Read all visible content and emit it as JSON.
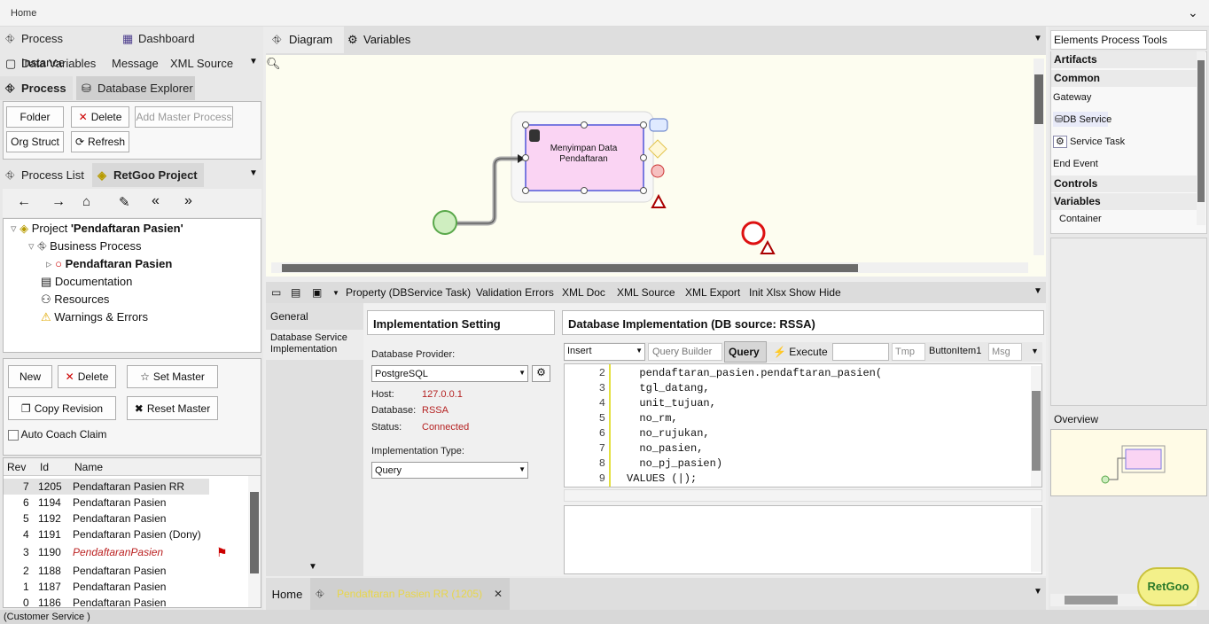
{
  "topbar": {
    "home": "Home"
  },
  "left": {
    "row1": {
      "process_instance": "Process Instance",
      "dashboard": "Dashboard"
    },
    "row2": {
      "data_variables": "Data Variables",
      "message": "Message",
      "xml_source": "XML Source"
    },
    "row3": {
      "process": "Process",
      "database_explorer": "Database Explorer"
    },
    "buttons": {
      "folder": "Folder",
      "delete": "Delete",
      "add_master": "Add Master Process",
      "org_struct": "Org Struct",
      "refresh": "Refresh"
    },
    "row4": {
      "process_list": "Process List",
      "retgoo_project": "RetGoo Project"
    },
    "tree": {
      "project_prefix": "Project ",
      "project_name": "'Pendaftaran Pasien'",
      "business_process": "Business Process",
      "pendaftaran": "Pendaftaran Pasien",
      "documentation": "Documentation",
      "resources": "Resources",
      "warnings": "Warnings & Errors"
    },
    "rev_buttons": {
      "new": "New",
      "delete": "Delete",
      "set_master": "Set Master",
      "copy_revision": "Copy Revision",
      "reset_master": "Reset Master",
      "auto_coach": "Auto Coach Claim"
    },
    "table": {
      "headers": [
        "Rev",
        "Id",
        "Name"
      ],
      "rows": [
        {
          "rev": "7",
          "id": "1205",
          "name": "Pendaftaran Pasien RR"
        },
        {
          "rev": "6",
          "id": "1194",
          "name": "Pendaftaran Pasien"
        },
        {
          "rev": "5",
          "id": "1192",
          "name": "Pendaftaran Pasien"
        },
        {
          "rev": "4",
          "id": "1191",
          "name": "Pendaftaran Pasien (Dony)"
        },
        {
          "rev": "3",
          "id": "1190",
          "name": "PendaftaranPasien"
        },
        {
          "rev": "2",
          "id": "1188",
          "name": "Pendaftaran Pasien"
        },
        {
          "rev": "1",
          "id": "1187",
          "name": "Pendaftaran Pasien"
        },
        {
          "rev": "0",
          "id": "1186",
          "name": "Pendaftaran Pasien"
        }
      ]
    }
  },
  "center": {
    "tabs": {
      "diagram": "Diagram",
      "variables": "Variables"
    },
    "task_label": "Menyimpan Data Pendaftaran",
    "prop_tabs": [
      "Property (DBService Task)",
      "Validation Errors",
      "XML Doc",
      "XML Source",
      "XML Export",
      "Init Xlsx",
      "Show",
      "Hide"
    ],
    "side": {
      "general": "General",
      "db_impl": "Database Service Implementation"
    },
    "impl": {
      "title": "Implementation Setting",
      "provider_label": "Database Provider:",
      "provider": "PostgreSQL",
      "host_label": "Host:",
      "host": "127.0.0.1",
      "db_label": "Database:",
      "db": "RSSA",
      "status_label": "Status:",
      "status": "Connected",
      "type_label": "Implementation Type:",
      "type": "Query"
    },
    "dbimpl": {
      "title": "Database Implementation (DB source: RSSA)",
      "insert": "Insert",
      "query_builder": "Query Builder",
      "query": "Query",
      "execute": "Execute",
      "tmp": "Tmp",
      "button_item": "ButtonItem1",
      "msg": "Msg"
    },
    "code": [
      {
        "n": "2",
        "t": "  pendaftaran_pasien.pendaftaran_pasien("
      },
      {
        "n": "3",
        "t": "  tgl_datang,"
      },
      {
        "n": "4",
        "t": "  unit_tujuan,"
      },
      {
        "n": "5",
        "t": "  no_rm,"
      },
      {
        "n": "6",
        "t": "  no_rujukan,"
      },
      {
        "n": "7",
        "t": "  no_pasien,"
      },
      {
        "n": "8",
        "t": "  no_pj_pasien)"
      },
      {
        "n": "9",
        "t": "VALUES (|);"
      }
    ],
    "bottom": {
      "home": "Home",
      "doc_tab": "Pendaftaran Pasien RR (1205)"
    }
  },
  "right": {
    "title": "Elements Process Tools",
    "artifacts": "Artifacts",
    "common": "Common",
    "gateway": "Gateway",
    "db_service": "DB Service",
    "service_task": "Service Task",
    "end_event": "End Event",
    "controls": "Controls",
    "variables": "Variables",
    "container": "Container",
    "overview": "Overview",
    "logo": "RetGoo"
  },
  "status": "(Customer Service )"
}
